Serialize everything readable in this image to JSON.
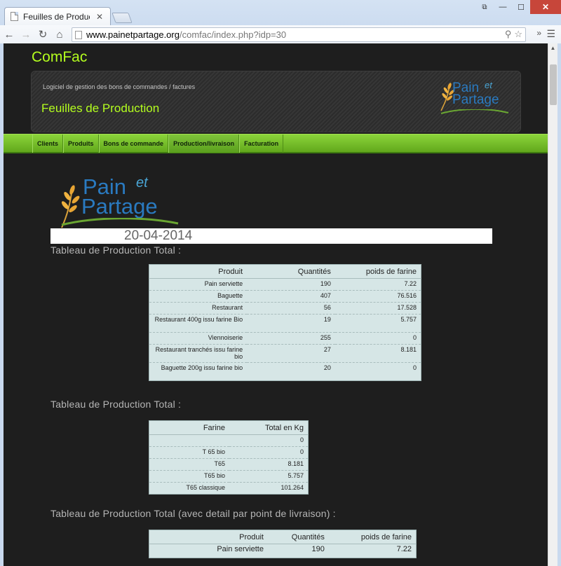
{
  "browser": {
    "tab_title": "Feuilles de Production",
    "url_host": "www.painetpartage.org",
    "url_path": "/comfac/index.php?idp=30",
    "icons": [
      "back-icon",
      "forward-icon",
      "reload-icon",
      "home-icon",
      "search-icon",
      "star-icon",
      "menu-icon"
    ],
    "accent": "#c9d9ee"
  },
  "site": {
    "title": "ComFac",
    "subtitle": "Logiciel de gestion des bons de commandes / factures",
    "page_heading": "Feuilles de Production",
    "logo": {
      "word1": "Pain",
      "word2": "et",
      "word3": "Partage"
    },
    "accent_green": "#b4ff1e"
  },
  "nav": {
    "items": [
      {
        "label": "Clients"
      },
      {
        "label": "Produits"
      },
      {
        "label": "Bons de commande"
      },
      {
        "label": "Production/livraison"
      },
      {
        "label": "Facturation"
      }
    ],
    "active": "Production/livraison"
  },
  "content": {
    "date": "20-04-2014",
    "section1_title": "Tableau de Production Total :",
    "section2_title": "Tableau de Production Total :",
    "section3_title": "Tableau de Production Total (avec detail par point de livraison) :",
    "table1": {
      "headers": [
        "Produit",
        "Quantités",
        "poids de farine"
      ],
      "rows": [
        [
          "Pain serviette",
          "190",
          "7.22"
        ],
        [
          "Baguette",
          "407",
          "76.516"
        ],
        [
          "Restaurant",
          "56",
          "17.528"
        ],
        [
          "Restaurant 400g issu farine Bio",
          "19",
          "5.757"
        ],
        [
          "Viennoiserie",
          "255",
          "0"
        ],
        [
          "Restaurant tranchés issu farine bio",
          "27",
          "8.181"
        ],
        [
          "Baguette 200g issu farine bio",
          "20",
          "0"
        ]
      ]
    },
    "table2": {
      "headers": [
        "Farine",
        "Total en Kg"
      ],
      "rows": [
        [
          "",
          "0"
        ],
        [
          "T 65 bio",
          "0"
        ],
        [
          "T65",
          "8.181"
        ],
        [
          "T65 bio",
          "5.757"
        ],
        [
          "T65 classique",
          "101.264"
        ]
      ]
    },
    "table3": {
      "headers": [
        "Produit",
        "Quantités",
        "poids de farine"
      ],
      "rows": [
        [
          "Pain serviette",
          "190",
          "7.22"
        ]
      ]
    }
  }
}
